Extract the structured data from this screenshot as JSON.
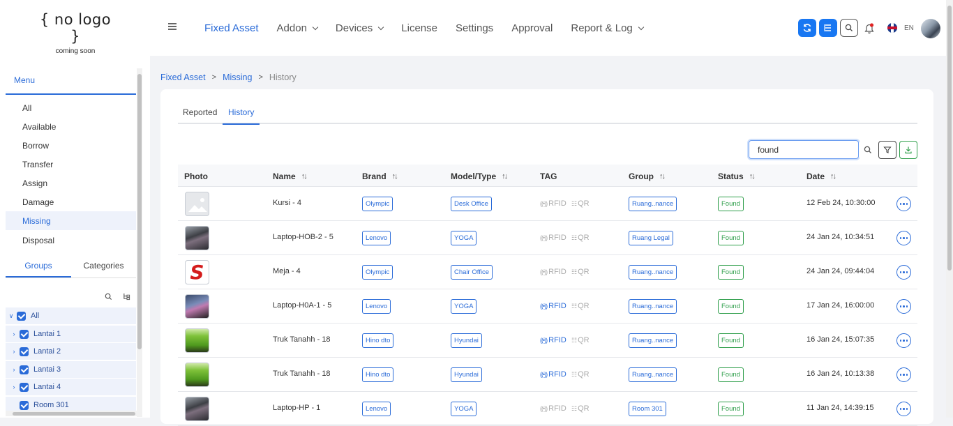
{
  "app": {
    "logo_line1": "{ no logo }",
    "logo_line2": "coming soon",
    "lang": "EN"
  },
  "nav": {
    "items": [
      {
        "label": "Fixed Asset",
        "active": true,
        "dropdown": false
      },
      {
        "label": "Addon",
        "active": false,
        "dropdown": true
      },
      {
        "label": "Devices",
        "active": false,
        "dropdown": true
      },
      {
        "label": "License",
        "active": false,
        "dropdown": false
      },
      {
        "label": "Settings",
        "active": false,
        "dropdown": false
      },
      {
        "label": "Approval",
        "active": false,
        "dropdown": false
      },
      {
        "label": "Report & Log",
        "active": false,
        "dropdown": true
      }
    ]
  },
  "topbar_icons": [
    "sync-icon",
    "list-icon",
    "search-icon",
    "bell-icon",
    "uk-flag-icon"
  ],
  "sidebar": {
    "menu_title": "Menu",
    "items": [
      "All",
      "Available",
      "Borrow",
      "Transfer",
      "Assign",
      "Damage",
      "Missing",
      "Disposal"
    ],
    "active_item": "Missing",
    "tabs": [
      "Groups",
      "Categories"
    ],
    "active_tab": "Groups",
    "tree": [
      {
        "label": "All",
        "checked": true,
        "expanded": true
      },
      {
        "label": "Lantai 1",
        "checked": true
      },
      {
        "label": "Lantai 2",
        "checked": true
      },
      {
        "label": "Lantai 3",
        "checked": true
      },
      {
        "label": "Lantai 4",
        "checked": true
      },
      {
        "label": "Room 301",
        "checked": true
      }
    ]
  },
  "breadcrumb": [
    "Fixed Asset",
    "Missing",
    "History"
  ],
  "tabs": [
    "Reported",
    "History"
  ],
  "active_tab": "History",
  "search": {
    "value": "found"
  },
  "table": {
    "columns": [
      "Photo",
      "Name",
      "Brand",
      "Model/Type",
      "TAG",
      "Group",
      "Status",
      "Date"
    ],
    "sortable": [
      false,
      true,
      true,
      true,
      false,
      true,
      true,
      true
    ],
    "tag_labels": {
      "rfid": "RFID",
      "qr": "QR"
    },
    "rows": [
      {
        "photo": "placeholder-image",
        "name": "Kursi - 4",
        "brand": "Olympic",
        "model": "Desk Office",
        "rfid_active": false,
        "group": "Ruang..nance",
        "status": "Found",
        "date": "12 Feb 24, 10:30:00"
      },
      {
        "photo": "laptop-photo",
        "name": "Laptop-HOB-2 - 5",
        "brand": "Lenovo",
        "model": "YOGA",
        "rfid_active": false,
        "group": "Ruang Legal",
        "status": "Found",
        "date": "24 Jan 24, 10:34:51"
      },
      {
        "photo": "s-logo-photo",
        "name": "Meja - 4",
        "brand": "Olympic",
        "model": "Chair Office",
        "rfid_active": false,
        "group": "Ruang..nance",
        "status": "Found",
        "date": "24 Jan 24, 09:44:04"
      },
      {
        "photo": "laptop-photo-2",
        "name": "Laptop-H0A-1 - 5",
        "brand": "Lenovo",
        "model": "YOGA",
        "rfid_active": true,
        "group": "Ruang..nance",
        "status": "Found",
        "date": "17 Jan 24, 16:00:00"
      },
      {
        "photo": "truck-photo",
        "name": "Truk Tanahh - 18",
        "brand": "Hino dto",
        "model": "Hyundai",
        "rfid_active": true,
        "group": "Ruang..nance",
        "status": "Found",
        "date": "16 Jan 24, 15:07:35"
      },
      {
        "photo": "truck-photo",
        "name": "Truk Tanahh - 18",
        "brand": "Hino dto",
        "model": "Hyundai",
        "rfid_active": true,
        "group": "Ruang..nance",
        "status": "Found",
        "date": "16 Jan 24, 10:13:38"
      },
      {
        "photo": "laptop-photo",
        "name": "Laptop-HP - 1",
        "brand": "Lenovo",
        "model": "YOGA",
        "rfid_active": false,
        "group": "Room 301",
        "status": "Found",
        "date": "11 Jan 24, 14:39:15"
      }
    ]
  },
  "colors": {
    "accent": "#2a6bd8",
    "status_found": "#2e9e4a",
    "topbar_button": "#1877f2"
  }
}
